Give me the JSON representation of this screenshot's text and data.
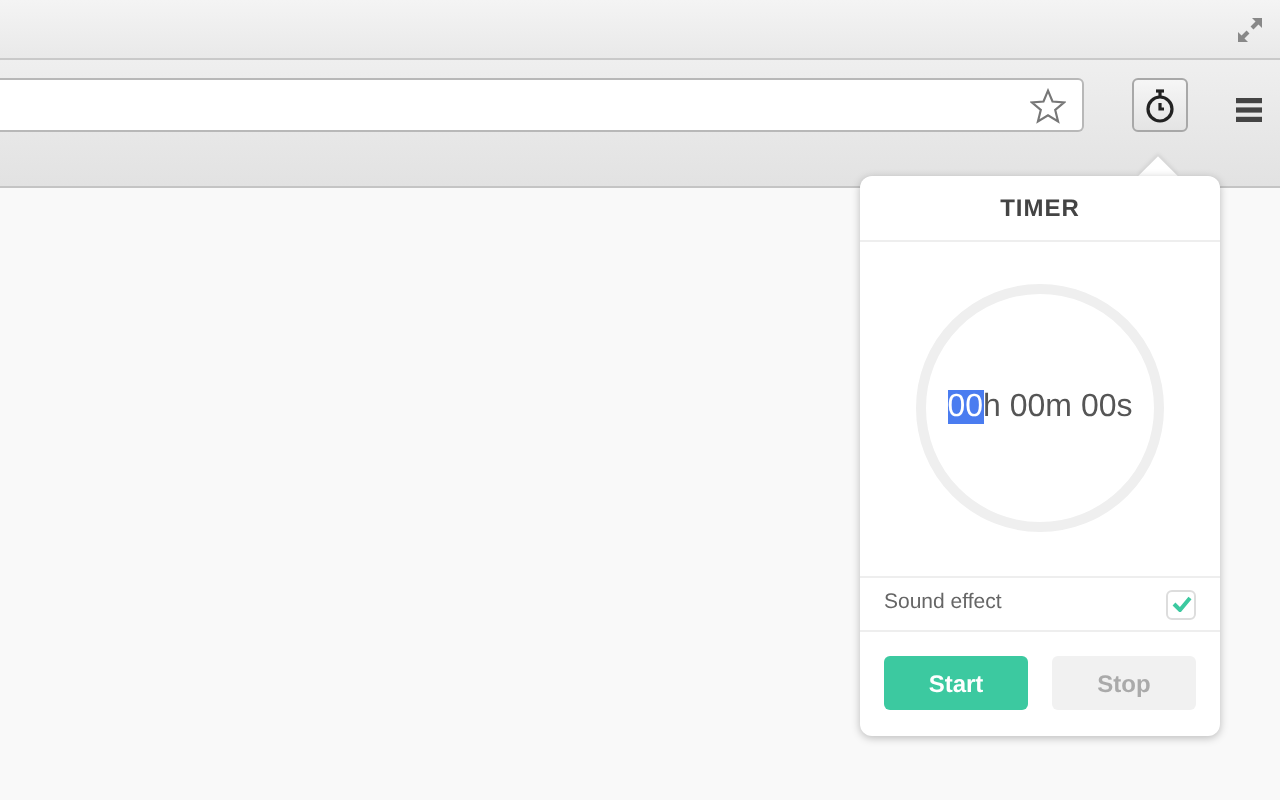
{
  "timer_popup": {
    "title": "TIMER",
    "time_parts": [
      {
        "text": "00",
        "selected": true
      },
      {
        "text": "h 00m 00s",
        "selected": false
      }
    ],
    "sound_effect": {
      "label": "Sound effect",
      "checked": true
    },
    "buttons": [
      {
        "label": "Start",
        "kind": "primary"
      },
      {
        "label": "Stop",
        "kind": "secondary"
      }
    ]
  }
}
